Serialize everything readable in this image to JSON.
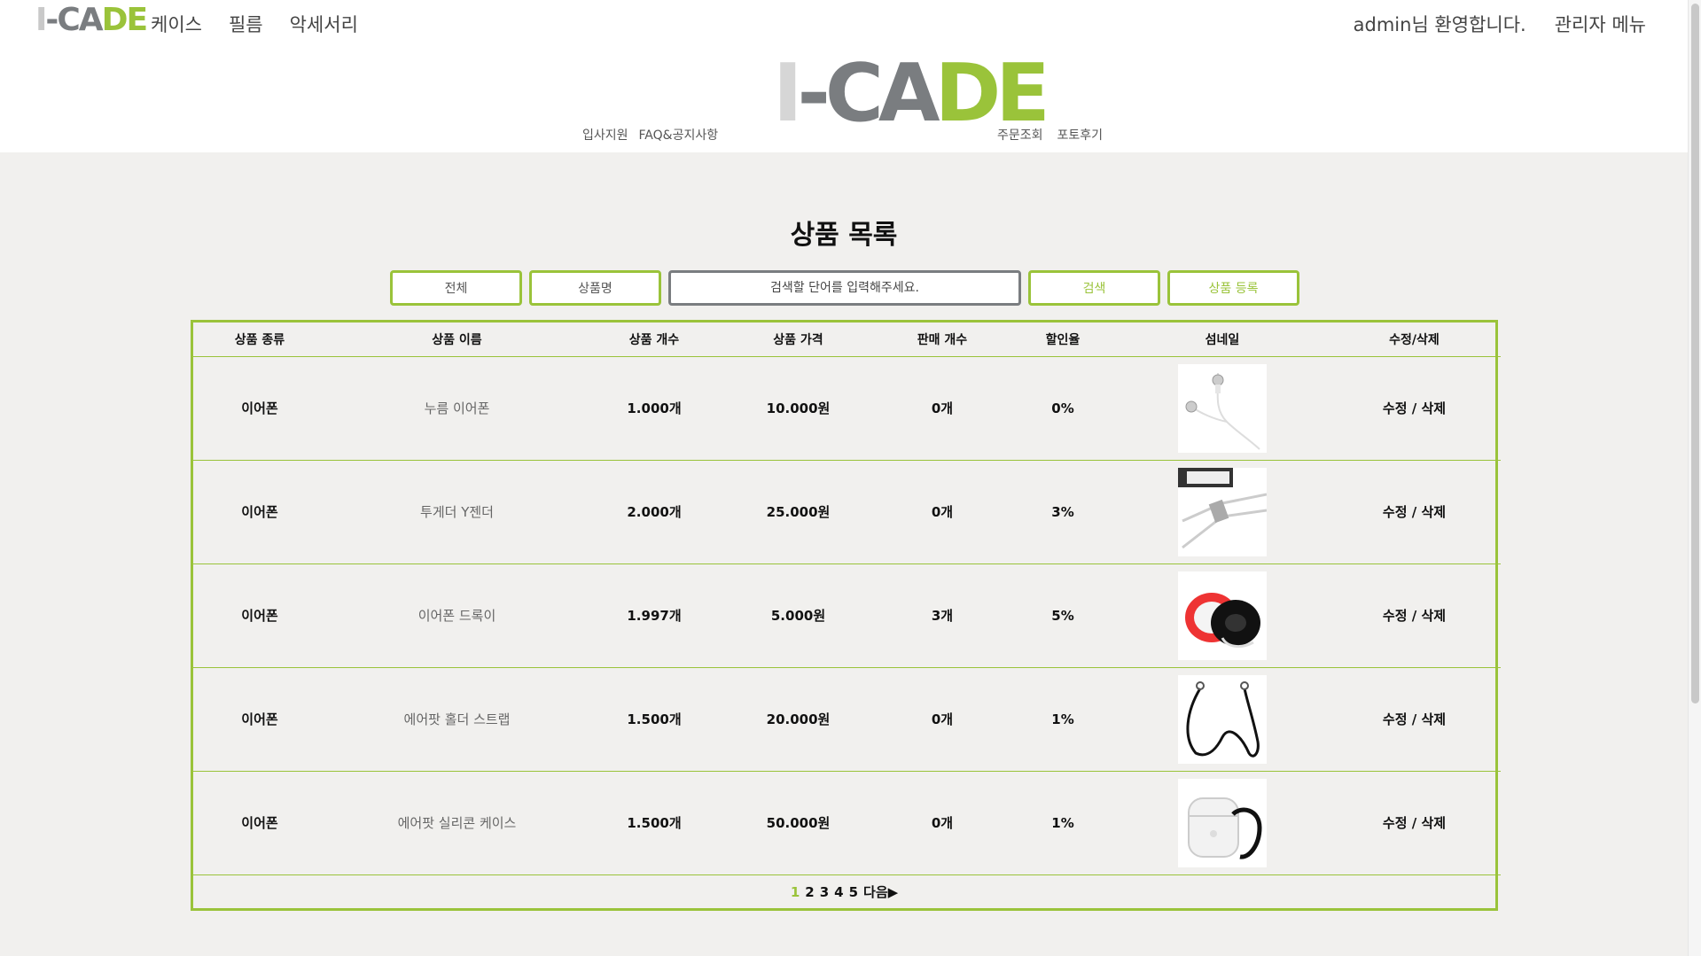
{
  "brand": {
    "logo_part1": "I",
    "logo_part2": "-CA",
    "logo_part3": "DE"
  },
  "nav": {
    "categories": [
      "케이스",
      "필름",
      "악세서리"
    ],
    "welcome": "admin님 환영합니다.",
    "admin_menu": "관리자 메뉴",
    "sub_left": [
      "입사지원",
      "FAQ&공지사항"
    ],
    "sub_right": [
      "주문조회",
      "포토후기"
    ]
  },
  "page": {
    "title": "상품 목록"
  },
  "search": {
    "filter_all": "전체",
    "filter_name": "상품명",
    "placeholder": "검색할 단어를 입력해주세요.",
    "search_button": "검색",
    "register_button": "상품 등록"
  },
  "table": {
    "headers": [
      "상품 종류",
      "상품 이름",
      "상품 개수",
      "상품 가격",
      "판매 개수",
      "할인율",
      "섬네일",
      "수정/삭제"
    ],
    "rows": [
      {
        "type": "이어폰",
        "name": "누름 이어폰",
        "stock": "1.000개",
        "price": "10.000원",
        "sold": "0개",
        "discount": "0%",
        "thumb": "white-earphones",
        "edit": "수정",
        "sep": "/",
        "delete": "삭제"
      },
      {
        "type": "이어폰",
        "name": "투게더 Y젠더",
        "stock": "2.000개",
        "price": "25.000원",
        "sold": "0개",
        "discount": "3%",
        "thumb": "y-splitter-cable",
        "edit": "수정",
        "sep": "/",
        "delete": "삭제"
      },
      {
        "type": "이어폰",
        "name": "이어폰 드록이",
        "stock": "1.997개",
        "price": "5.000원",
        "sold": "3개",
        "discount": "5%",
        "thumb": "earphone-winder",
        "edit": "수정",
        "sep": "/",
        "delete": "삭제"
      },
      {
        "type": "이어폰",
        "name": "에어팟 홀더 스트랩",
        "stock": "1.500개",
        "price": "20.000원",
        "sold": "0개",
        "discount": "1%",
        "thumb": "airpod-strap",
        "edit": "수정",
        "sep": "/",
        "delete": "삭제"
      },
      {
        "type": "이어폰",
        "name": "에어팟 실리콘 케이스",
        "stock": "1.500개",
        "price": "50.000원",
        "sold": "0개",
        "discount": "1%",
        "thumb": "airpod-silicone-case",
        "edit": "수정",
        "sep": "/",
        "delete": "삭제"
      }
    ]
  },
  "pagination": {
    "pages": [
      "1",
      "2",
      "3",
      "4",
      "5"
    ],
    "current": "1",
    "next": "다음▶"
  },
  "colors": {
    "accent": "#9ac33a",
    "gray": "#7a7d80",
    "light_gray": "#c9c9c9",
    "background": "#f1f0ee"
  }
}
